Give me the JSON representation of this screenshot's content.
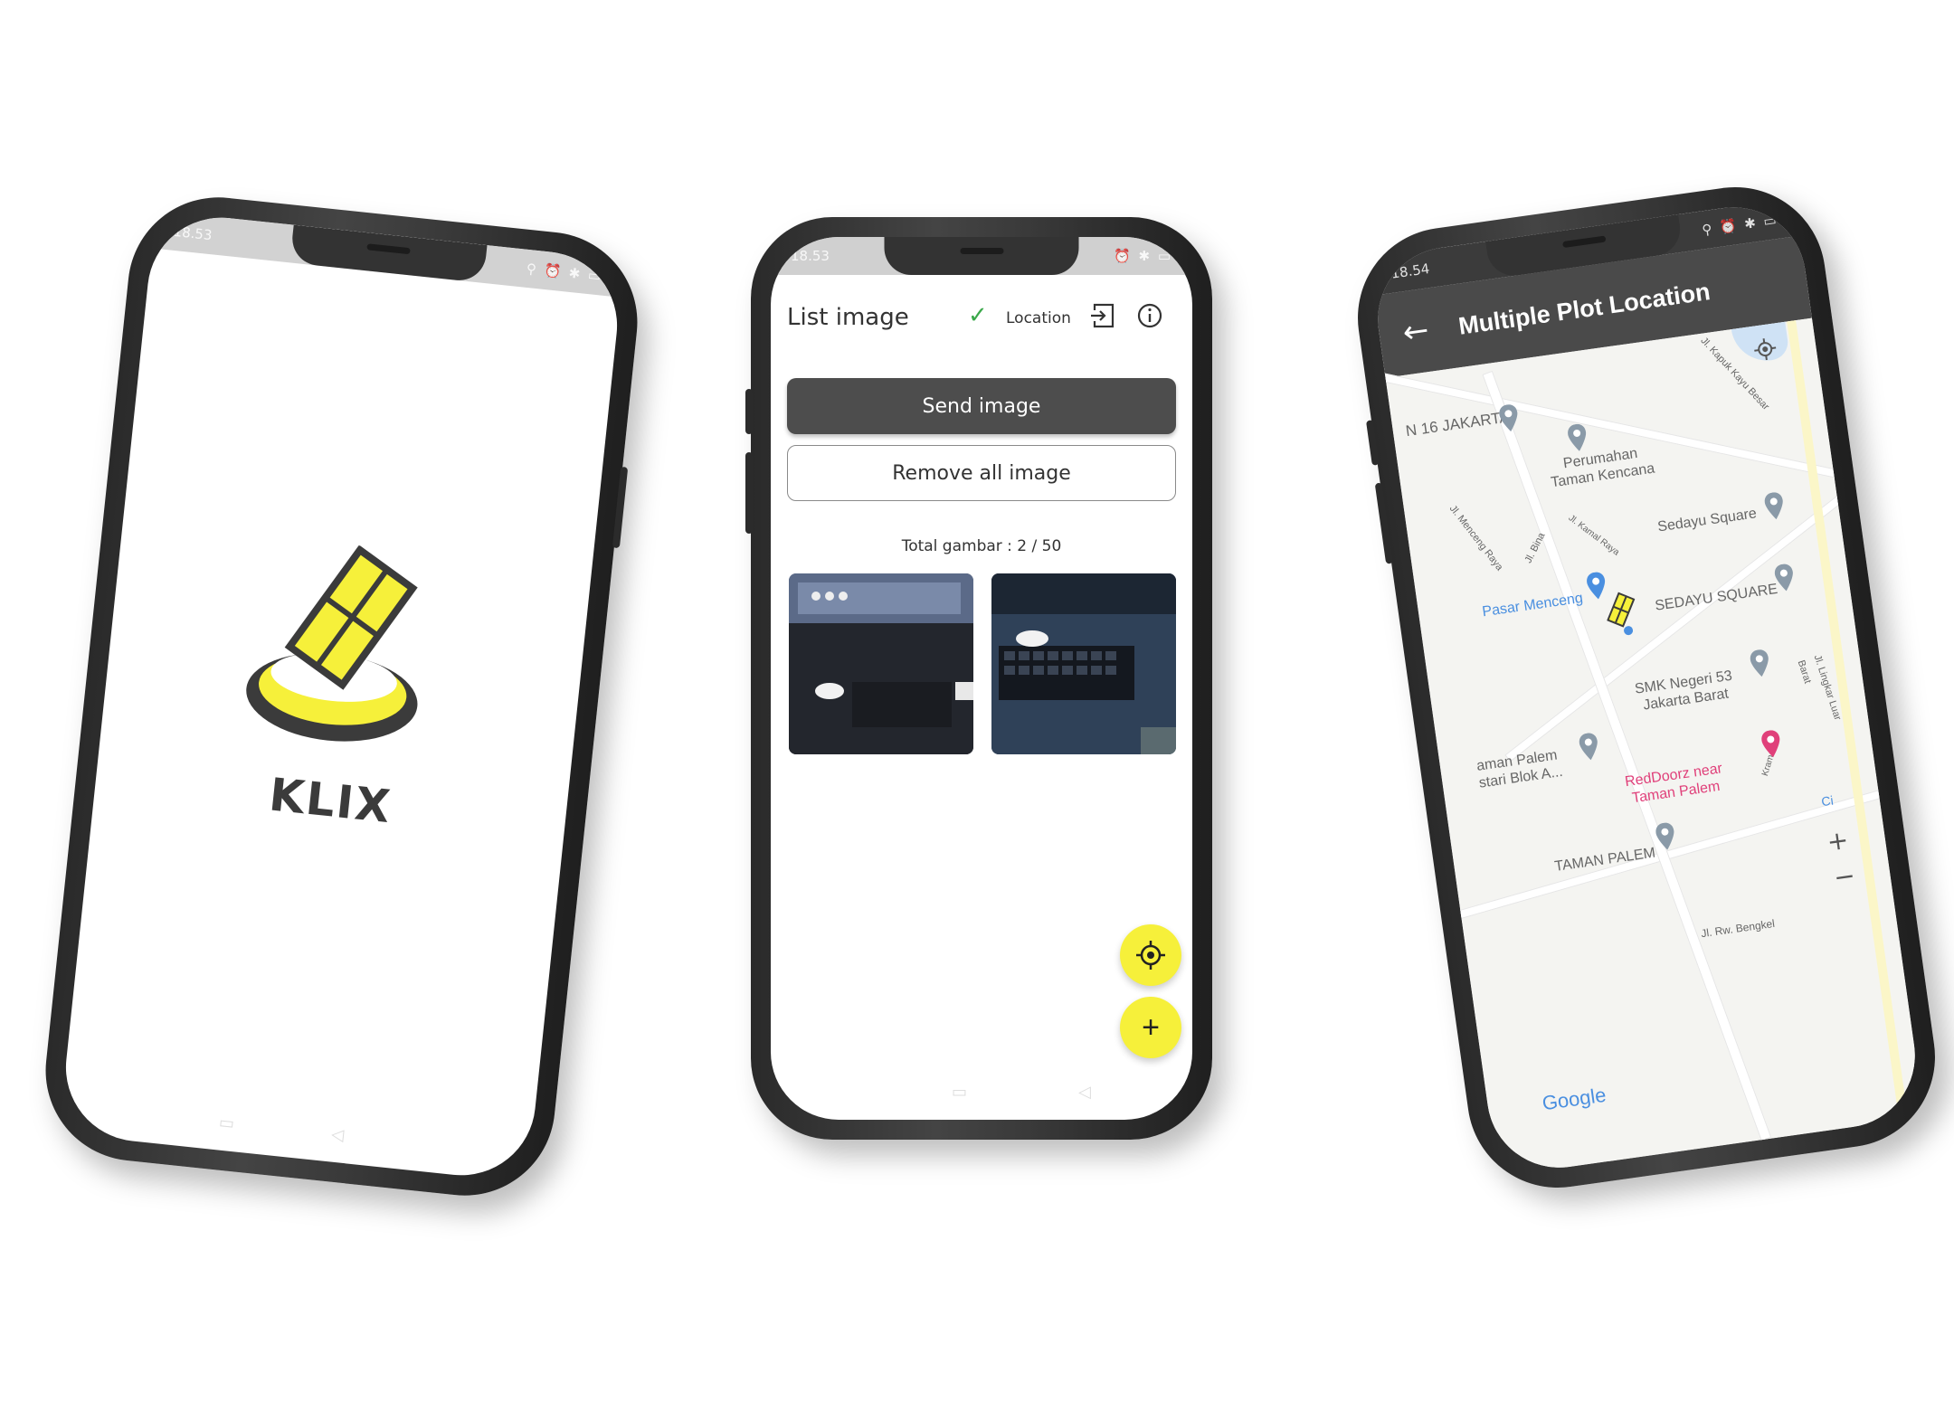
{
  "phone1": {
    "status": {
      "time": "18.53",
      "icons": "⚲ ⏰ ✱ ▭"
    },
    "brand": "KLIX",
    "colors": {
      "accent": "#f6f03a",
      "ink": "#3b3b3b"
    }
  },
  "phone2": {
    "status": {
      "time": "18.53",
      "icons": "⏰ ✱ ▭"
    },
    "appbar": {
      "title": "List image",
      "location_label": "Location"
    },
    "send_label": "Send image",
    "remove_label": "Remove all image",
    "total": "Total gambar : 2 / 50",
    "colors": {
      "fab": "#f6f03a",
      "check": "#3aa84a",
      "primary": "#4d4d4d"
    }
  },
  "phone3": {
    "status": {
      "time": "18.54",
      "icons": "⚲ ⏰ ✱ ▭"
    },
    "toolbar": {
      "title": "Multiple Plot Location"
    },
    "places": {
      "smp16": "N 16 JAKARTA",
      "perumahan_1": "Perumahan",
      "perumahan_2": "Taman Kencana",
      "sedayu_1": "Sedayu Square",
      "pasar": "Pasar Menceng",
      "sedayu_2": "SEDAYU SQUARE",
      "smk_1": "SMK Negeri 53",
      "smk_2": "Jakarta Barat",
      "tamanpalem_1": "aman Palem",
      "tamanpalem_2": "stari Blok A...",
      "reddoorz_1": "RedDoorz near",
      "reddoorz_2": "Taman Palem",
      "tamanpalem_caps": "TAMAN PALEM",
      "road_bengkel": "Jl. Rw. Bengkel",
      "road_kapuk": "Jl. Kapuk Kayu Besar",
      "road_menceng": "Jl. Menceng Raya",
      "road_bina": "Jl. Bina",
      "road_kamal": "Jl. Kamal Raya",
      "road_right": "Jl. Lingkar Luar Barat",
      "road_kramat": "Kramat",
      "other": "Ci"
    },
    "google": "Google",
    "zoom": {
      "in": "+",
      "out": "−"
    }
  }
}
